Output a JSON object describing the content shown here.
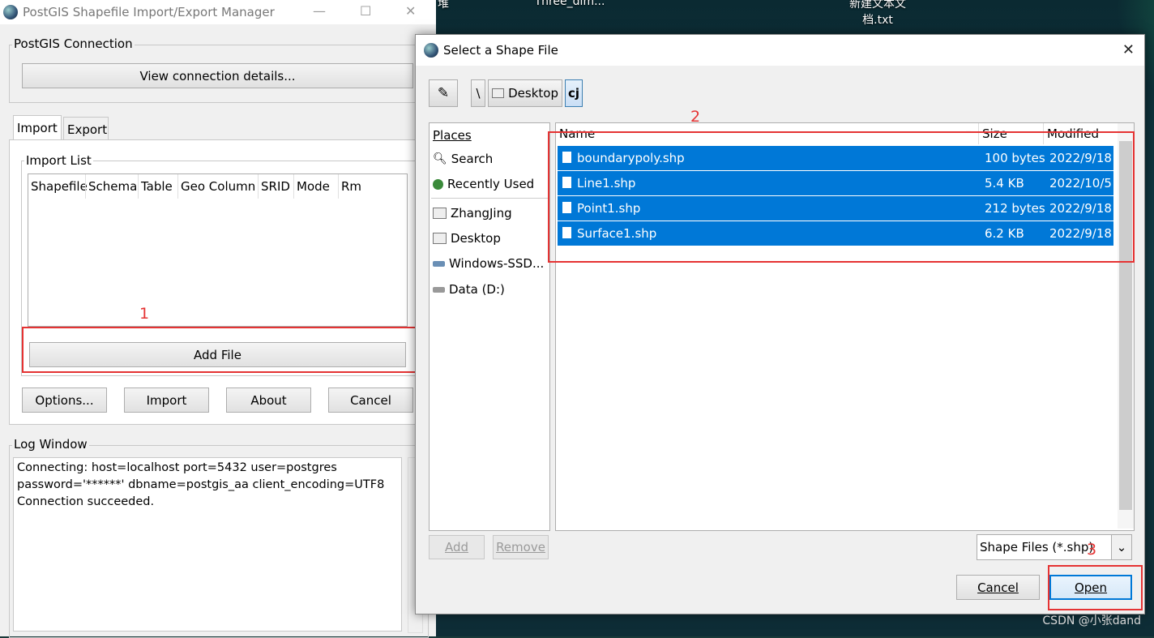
{
  "main_window": {
    "title": "PostGIS Shapefile Import/Export Manager",
    "connection_group": "PostGIS Connection",
    "view_connection_button": "View connection details...",
    "tabs": [
      "Import",
      "Export"
    ],
    "import_list_label": "Import List",
    "columns": [
      "Shapefile",
      "Schema",
      "Table",
      "Geo Column",
      "SRID",
      "Mode",
      "Rm"
    ],
    "add_file_button": "Add File",
    "buttons": {
      "options": "Options...",
      "import": "Import",
      "about": "About",
      "cancel": "Cancel"
    },
    "log_label": "Log Window",
    "log_lines": [
      "Connecting:  host=localhost port=5432 user=postgres",
      "password='******' dbname=postgis_aa client_encoding=UTF8",
      "Connection succeeded."
    ]
  },
  "desktop": {
    "icon1": "Three_dim...",
    "icon2_line1": "新建文本文",
    "icon2_line2": "档.txt",
    "partial": "堆"
  },
  "dialog": {
    "title": "Select a Shape File",
    "path": {
      "root": "\\",
      "desktop": "Desktop",
      "current": "cj"
    },
    "places_header": "Places",
    "places": [
      "Search",
      "Recently Used",
      "ZhangJing",
      "Desktop",
      "Windows-SSD...",
      "Data (D:)"
    ],
    "file_headers": {
      "name": "Name",
      "size": "Size",
      "modified": "Modified"
    },
    "files": [
      {
        "name": "boundarypoly.shp",
        "size": "100 bytes",
        "modified": "2022/9/18"
      },
      {
        "name": "Line1.shp",
        "size": "5.4 KB",
        "modified": "2022/10/5"
      },
      {
        "name": "Point1.shp",
        "size": "212 bytes",
        "modified": "2022/9/18"
      },
      {
        "name": "Surface1.shp",
        "size": "6.2 KB",
        "modified": "2022/9/18"
      }
    ],
    "add_button": "Add",
    "remove_button": "Remove",
    "filter": "Shape Files (*.shp)",
    "cancel_button": "Cancel",
    "open_button": "Open"
  },
  "annotations": {
    "one": "1",
    "two": "2",
    "three": "3"
  },
  "watermark": "CSDN @小张dand"
}
